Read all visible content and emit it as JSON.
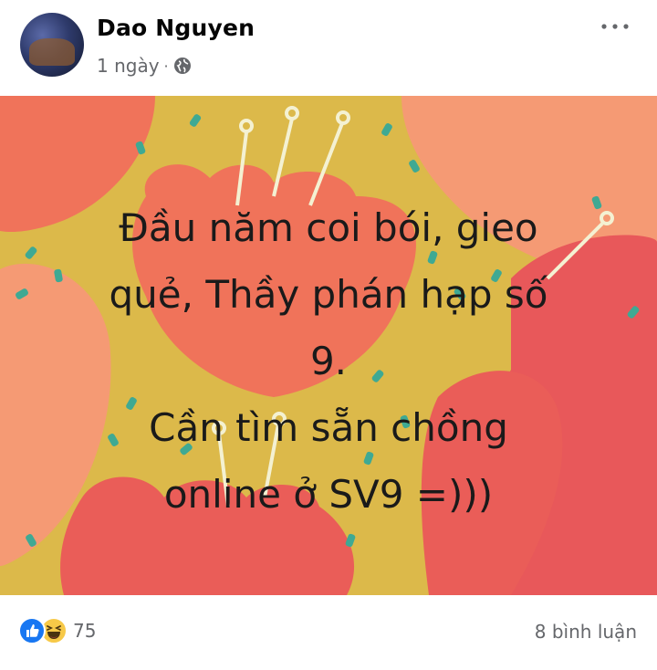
{
  "post": {
    "author": "Dao Nguyen",
    "timestamp": "1 ngày",
    "separator": "·",
    "text": "Đầu năm coi bói, gieo\nquẻ, Thầy phán hạp số\n9.\nCần tìm sẵn chồng\nonline ở SV9 =)))",
    "reactions_count": "75",
    "comments": "8 bình luận"
  },
  "icons": {
    "privacy": "globe-icon",
    "menu": "more-horizontal-icon",
    "reaction_1": "like-icon",
    "reaction_2": "haha-icon"
  },
  "colors": {
    "background": "#dcb94a",
    "petal": "#f0735a",
    "petal_light": "#f59a74",
    "dots": "#3fa993",
    "stems": "#f4f1d2",
    "meta_text": "#65676b"
  }
}
